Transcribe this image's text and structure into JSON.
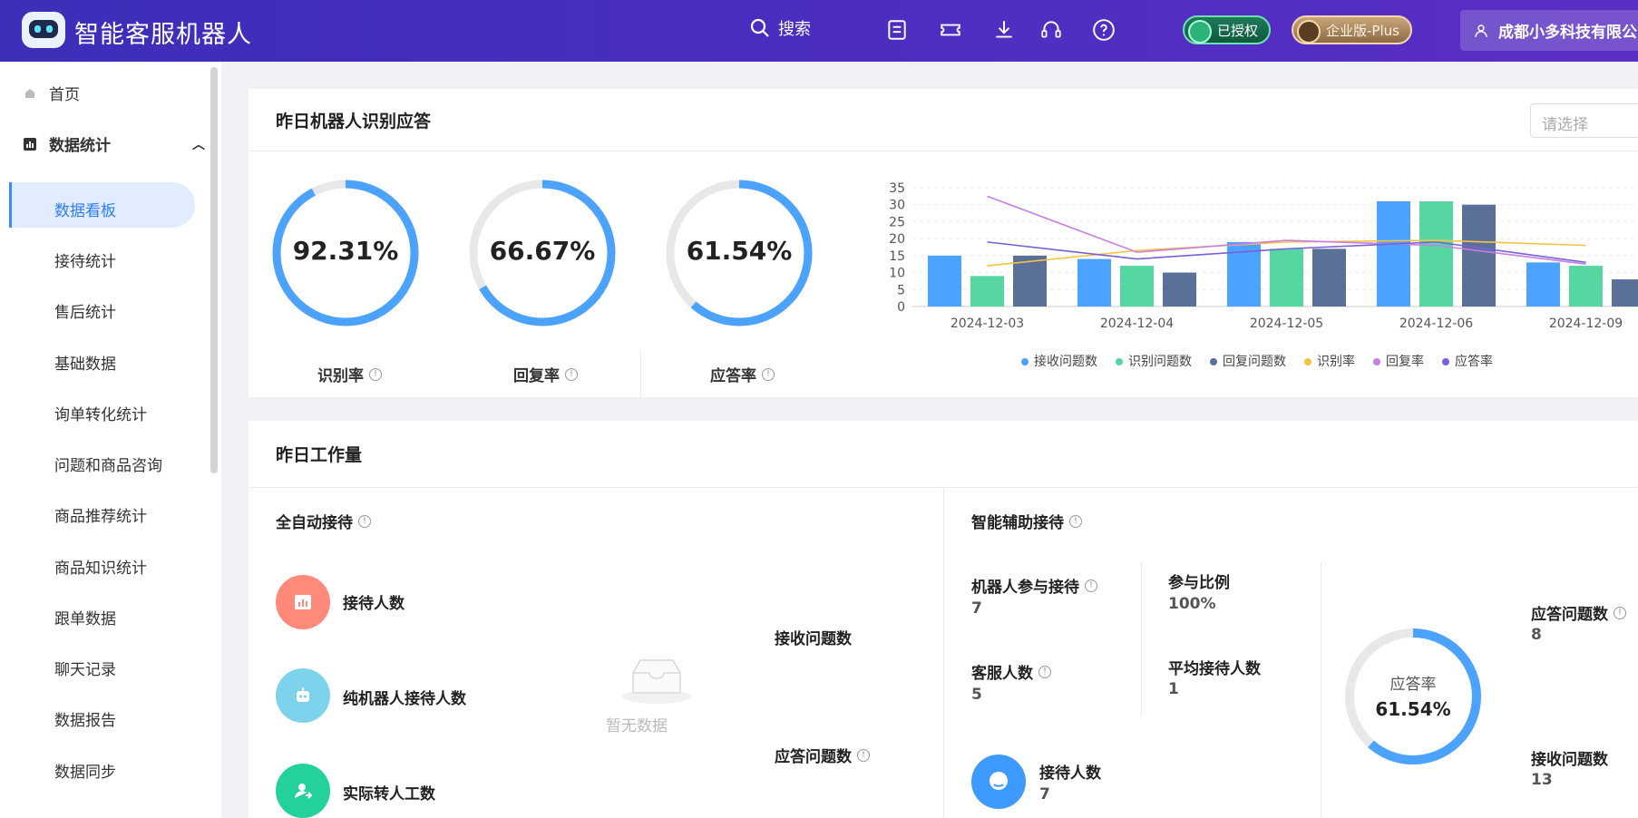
{
  "header": {
    "app_title": "智能客服机器人",
    "search_label": "搜索",
    "auth_badge": "已授权",
    "edition_badge": "企业版-Plus",
    "user_company": "成都小多科技有限公司"
  },
  "sidebar": {
    "home": "首页",
    "group": "数据统计",
    "items": [
      {
        "label": "数据看板",
        "active": true
      },
      {
        "label": "接待统计"
      },
      {
        "label": "售后统计"
      },
      {
        "label": "基础数据"
      },
      {
        "label": "询单转化统计"
      },
      {
        "label": "问题和商品咨询"
      },
      {
        "label": "商品推荐统计"
      },
      {
        "label": "商品知识统计"
      },
      {
        "label": "跟单数据"
      },
      {
        "label": "聊天记录"
      },
      {
        "label": "数据报告"
      },
      {
        "label": "数据同步"
      }
    ]
  },
  "recognition": {
    "title": "昨日机器人识别应答",
    "select_placeholder": "请选择",
    "gauges": [
      {
        "label": "识别率",
        "value": "92.31%",
        "fraction": 0.9231
      },
      {
        "label": "回复率",
        "value": "66.67%",
        "fraction": 0.6667
      },
      {
        "label": "应答率",
        "value": "61.54%",
        "fraction": 0.6154
      }
    ]
  },
  "chart_data": {
    "type": "bar",
    "categories": [
      "2024-12-03",
      "2024-12-04",
      "2024-12-05",
      "2024-12-06",
      "2024-12-09"
    ],
    "ylim": [
      0,
      35
    ],
    "yticks": [
      0,
      5,
      10,
      15,
      20,
      25,
      30,
      35
    ],
    "series": [
      {
        "name": "接收问题数",
        "kind": "bar",
        "color": "#4ba3ff",
        "values": [
          15,
          14,
          19,
          31,
          13
        ]
      },
      {
        "name": "识别问题数",
        "kind": "bar",
        "color": "#56d6a0",
        "values": [
          9,
          12,
          17,
          31,
          12
        ]
      },
      {
        "name": "回复问题数",
        "kind": "bar",
        "color": "#5b7099",
        "values": [
          15,
          10,
          17,
          30,
          8
        ]
      },
      {
        "name": "识别率",
        "kind": "line",
        "color": "#f5c242",
        "values": [
          12,
          16.5,
          19,
          19.5,
          18
        ]
      },
      {
        "name": "回复率",
        "kind": "line",
        "color": "#c77ee6",
        "values": [
          32.5,
          16,
          19.5,
          18,
          12.5
        ]
      },
      {
        "name": "应答率",
        "kind": "line",
        "color": "#7b5fd9",
        "values": [
          19,
          14,
          17,
          19,
          13
        ]
      }
    ]
  },
  "workload": {
    "title": "昨日工作量",
    "auto": {
      "title": "全自动接待",
      "metrics": [
        "接待人数",
        "纯机器人接待人数",
        "实际转人工数"
      ],
      "right_labels": [
        "接收问题数",
        "应答问题数"
      ],
      "empty_text": "暂无数据"
    },
    "assist": {
      "title": "智能辅助接待",
      "robot_participation_label": "机器人参与接待",
      "robot_participation_value": "7",
      "ratio_label": "参与比例",
      "ratio_value": "100%",
      "agents_label": "客服人数",
      "agents_value": "5",
      "avg_label": "平均接待人数",
      "avg_value": "1",
      "reception_label": "接待人数",
      "reception_value": "7",
      "ring_label": "应答率",
      "ring_value": "61.54%",
      "ring_fraction": 0.6154,
      "answered_label": "应答问题数",
      "answered_value": "8",
      "received_label": "接收问题数",
      "received_value": "13"
    }
  }
}
